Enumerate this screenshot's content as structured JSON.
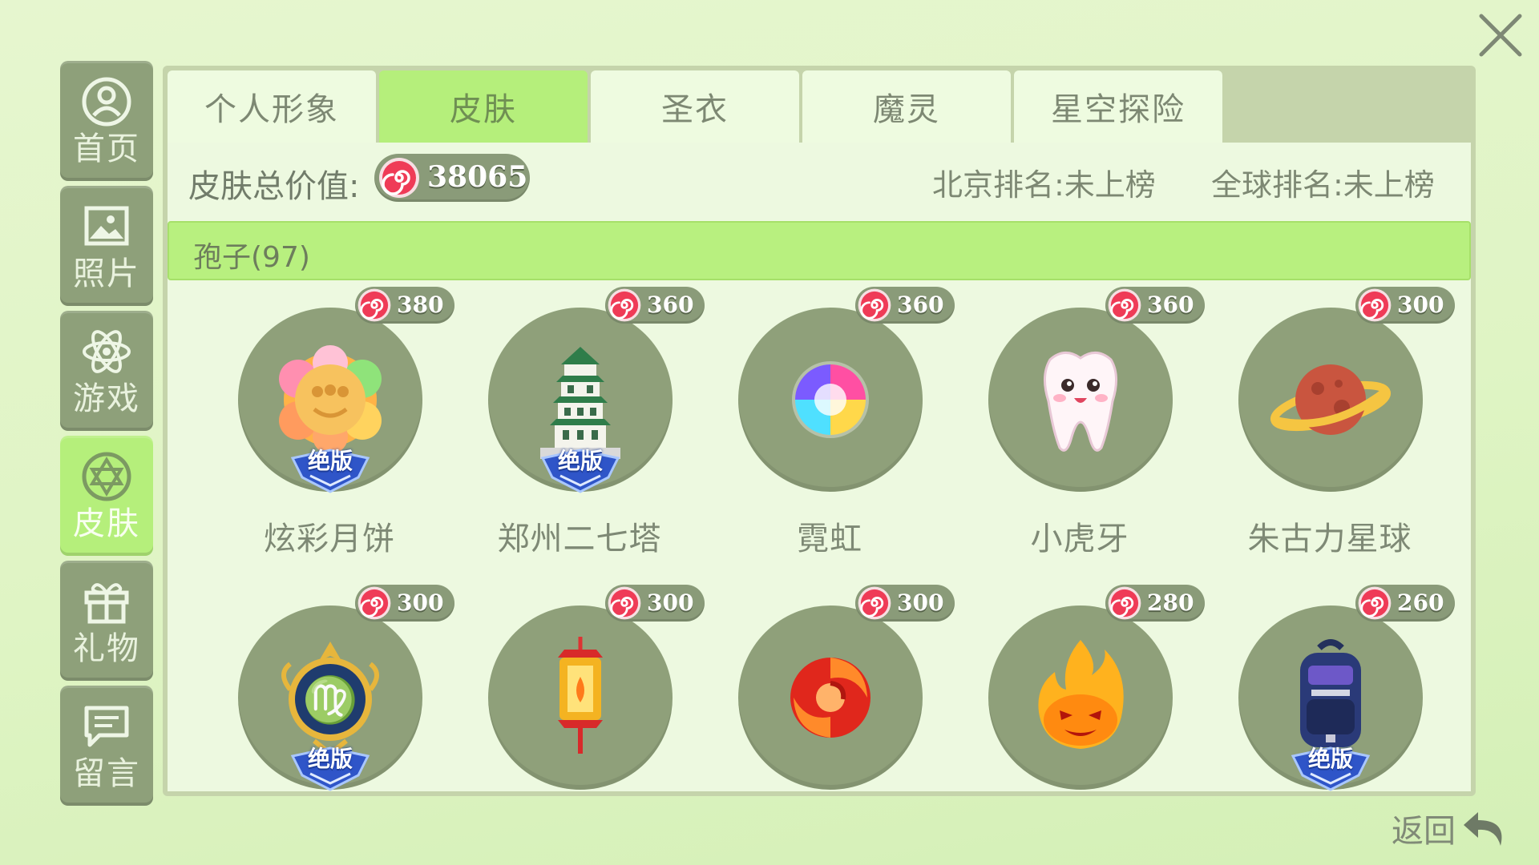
{
  "sidebar": {
    "items": [
      {
        "label": "首页",
        "icon": "user-icon"
      },
      {
        "label": "照片",
        "icon": "photo-icon"
      },
      {
        "label": "游戏",
        "icon": "atom-icon"
      },
      {
        "label": "皮肤",
        "icon": "skin-icon",
        "active": true
      },
      {
        "label": "礼物",
        "icon": "gift-icon"
      },
      {
        "label": "留言",
        "icon": "message-icon"
      }
    ]
  },
  "tabs": [
    {
      "label": "个人形象"
    },
    {
      "label": "皮肤",
      "active": true
    },
    {
      "label": "圣衣"
    },
    {
      "label": "魔灵"
    },
    {
      "label": "星空探险"
    }
  ],
  "summary": {
    "total_label": "皮肤总价值:",
    "total_value": "38065",
    "beijing_rank": "北京排名:未上榜",
    "global_rank": "全球排名:未上榜"
  },
  "section": {
    "title": "孢子(97)"
  },
  "items": [
    {
      "name": "炫彩月饼",
      "price": "380",
      "badge": "绝版",
      "art": "mooncake-icon"
    },
    {
      "name": "郑州二七塔",
      "price": "360",
      "badge": "绝版",
      "art": "pagoda-tower-icon"
    },
    {
      "name": "霓虹",
      "price": "360",
      "badge": "",
      "art": "neon-orb-icon"
    },
    {
      "name": "小虎牙",
      "price": "360",
      "badge": "",
      "art": "tooth-icon"
    },
    {
      "name": "朱古力星球",
      "price": "300",
      "badge": "",
      "art": "planet-icon"
    },
    {
      "name": "",
      "price": "300",
      "badge": "绝版",
      "art": "virgo-emblem-icon"
    },
    {
      "name": "",
      "price": "300",
      "badge": "",
      "art": "lantern-icon"
    },
    {
      "name": "",
      "price": "300",
      "badge": "",
      "art": "red-swirl-icon"
    },
    {
      "name": "",
      "price": "280",
      "badge": "",
      "art": "fire-face-icon"
    },
    {
      "name": "",
      "price": "260",
      "badge": "绝版",
      "art": "backpack-icon"
    }
  ],
  "back": {
    "label": "返回"
  },
  "colors": {
    "background": "#e2f5c9",
    "accent_green": "#b5ef7b",
    "tile_dark": "#8ea07a",
    "candy_red": "#ef3b57",
    "badge_blue": "#2f55c8"
  }
}
